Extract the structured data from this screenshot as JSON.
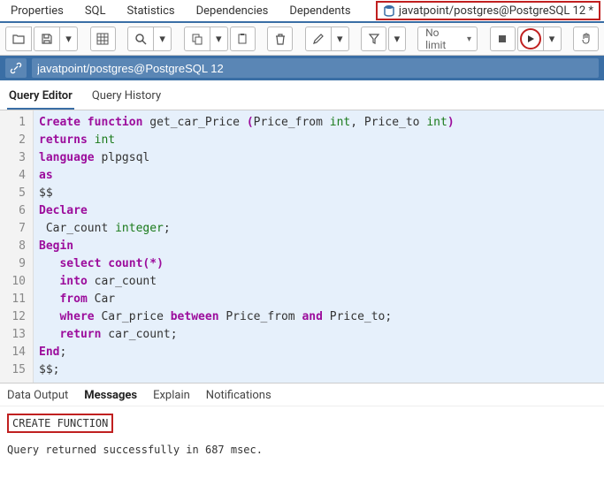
{
  "topTabs": {
    "properties": "Properties",
    "sql": "SQL",
    "statistics": "Statistics",
    "dependencies": "Dependencies",
    "dependents": "Dependents",
    "dbTab": "javatpoint/postgres@PostgreSQL 12 *"
  },
  "toolbar": {
    "limit": "No limit"
  },
  "conn": {
    "value": "javatpoint/postgres@PostgreSQL 12"
  },
  "subTabs": {
    "editor": "Query Editor",
    "history": "Query History"
  },
  "lines": [
    "1",
    "2",
    "3",
    "4",
    "5",
    "6",
    "7",
    "8",
    "9",
    "10",
    "11",
    "12",
    "13",
    "14",
    "15"
  ],
  "code": {
    "l1a": "Create",
    "l1b": " function",
    "l1c": " get_car_Price ",
    "l1d": "(",
    "l1e": "Price_from ",
    "l1f": "int",
    "l1g": ", ",
    "l1h": "Price_to ",
    "l1i": "int",
    "l1j": ")",
    "l2a": "returns ",
    "l2b": "int",
    "l3a": "language ",
    "l3b": "plpgsql",
    "l4": "as",
    "l5": "$$",
    "l6": "Declare",
    "l7a": " Car_count ",
    "l7b": "integer",
    "l7c": ";",
    "l8": "Begin",
    "l9a": "   select",
    "l9b": " count",
    "l9c": "(",
    "l9d": "*",
    "l9e": ")",
    "l10a": "   into ",
    "l10b": "car_count",
    "l11a": "   from ",
    "l11b": "Car",
    "l12a": "   where ",
    "l12b": "Car_price ",
    "l12c": "between ",
    "l12d": "Price_from ",
    "l12e": "and ",
    "l12f": "Price_to;",
    "l13a": "   return ",
    "l13b": "car_count;",
    "l14a": "End",
    "l14b": ";",
    "l15": "$$;"
  },
  "botTabs": {
    "data": "Data Output",
    "msg": "Messages",
    "explain": "Explain",
    "notif": "Notifications"
  },
  "messages": {
    "result": "CREATE FUNCTION",
    "status": "Query returned successfully in 687 msec."
  }
}
